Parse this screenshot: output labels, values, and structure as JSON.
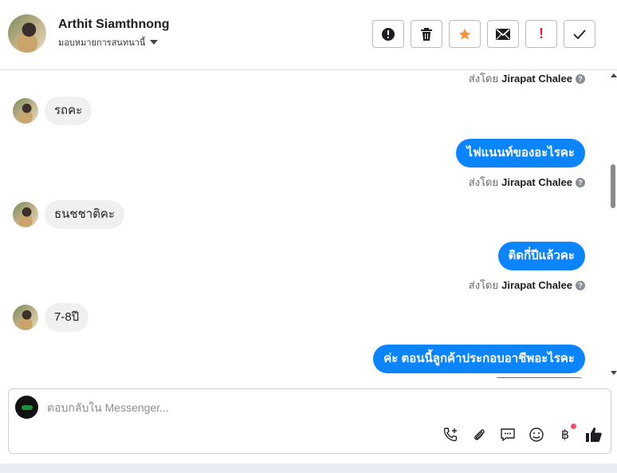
{
  "header": {
    "contact_name": "Arthit Siamthnong",
    "assign_label": "มอบหมายการสนทนานี้",
    "actions": [
      {
        "name": "report-button",
        "icon": "exclamation-circle-icon"
      },
      {
        "name": "delete-button",
        "icon": "trash-icon"
      },
      {
        "name": "star-button",
        "icon": "star-icon"
      },
      {
        "name": "mark-unread-button",
        "icon": "envelope-icon"
      },
      {
        "name": "spam-button",
        "icon": "exclamation-icon",
        "glyph": "!"
      },
      {
        "name": "mark-done-button",
        "icon": "check-icon"
      }
    ]
  },
  "messages": [
    {
      "direction": "out-meta",
      "sent_prefix": "ส่งโดย",
      "sender": "Jirapat Chalee"
    },
    {
      "direction": "in",
      "text": "รถคะ"
    },
    {
      "direction": "out",
      "text": "ไฟแนนท์ของอะไรคะ",
      "sent_prefix": "ส่งโดย",
      "sender": "Jirapat Chalee"
    },
    {
      "direction": "in",
      "text": "ธนชชาติคะ"
    },
    {
      "direction": "out",
      "text": "ติดกี่ปีแล้วคะ",
      "sent_prefix": "ส่งโดย",
      "sender": "Jirapat Chalee"
    },
    {
      "direction": "in",
      "text": "7-8ปี"
    },
    {
      "direction": "out",
      "text": "ค่ะ ตอนนี้ลูกค้าประกอบอาชีพอะไรคะ"
    }
  ],
  "composer": {
    "placeholder": "ตอบกลับใน Messenger...",
    "currency_glyph": "฿",
    "tools": [
      "call-add-icon",
      "attachment-icon",
      "saved-reply-icon",
      "emoji-icon",
      "payment-icon",
      "like-icon"
    ]
  },
  "colors": {
    "brand_blue": "#0b84ff",
    "incoming_bg": "#f0f0f0",
    "star": "#f7923a",
    "alert_red": "#e41e3f",
    "notification_dot": "#f25268"
  }
}
